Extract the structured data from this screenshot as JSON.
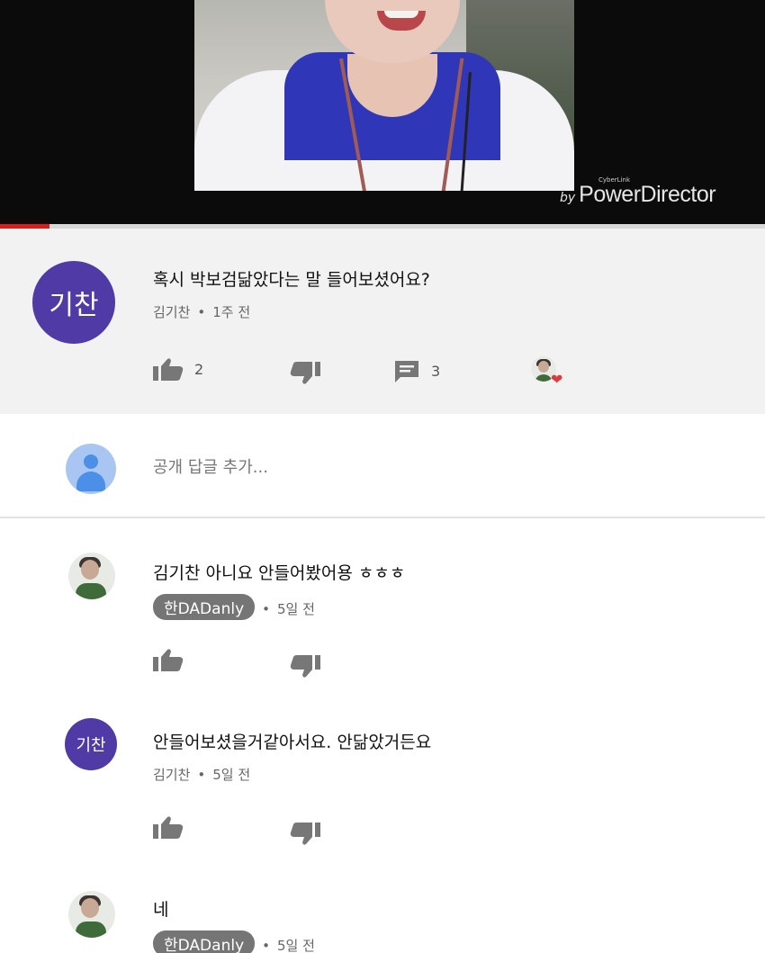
{
  "video": {
    "watermark_small": "CyberLink",
    "watermark_by": "by",
    "watermark_brand": "PowerDirector",
    "progress_fraction": 0.065,
    "progress_color": "#e01b1b"
  },
  "main_comment": {
    "avatar_text": "기찬",
    "avatar_color": "#4f3aa6",
    "text": "혹시 박보검닮았다는 말 들어보셨어요?",
    "author": "김기찬",
    "time": "1주 전",
    "like_count": "2",
    "reply_count": "3",
    "creator_heart_icon": "heart-icon"
  },
  "reply_box": {
    "placeholder": "공개 답글 추가..."
  },
  "replies": [
    {
      "text": "김기찬 아니요 안들어봤어용 ㅎㅎㅎ",
      "author": "한DADanly",
      "author_is_chip": true,
      "time": "5일 전",
      "avatar": "profile-photo"
    },
    {
      "text": "안들어보셨을거같아서요. 안닮았거든요",
      "author": "김기찬",
      "author_is_chip": false,
      "avatar_text": "기찬",
      "time": "5일 전"
    },
    {
      "text": "네",
      "author": "한DADanly",
      "author_is_chip": true,
      "time": "5일 전",
      "avatar": "profile-photo"
    }
  ],
  "separator": "•"
}
